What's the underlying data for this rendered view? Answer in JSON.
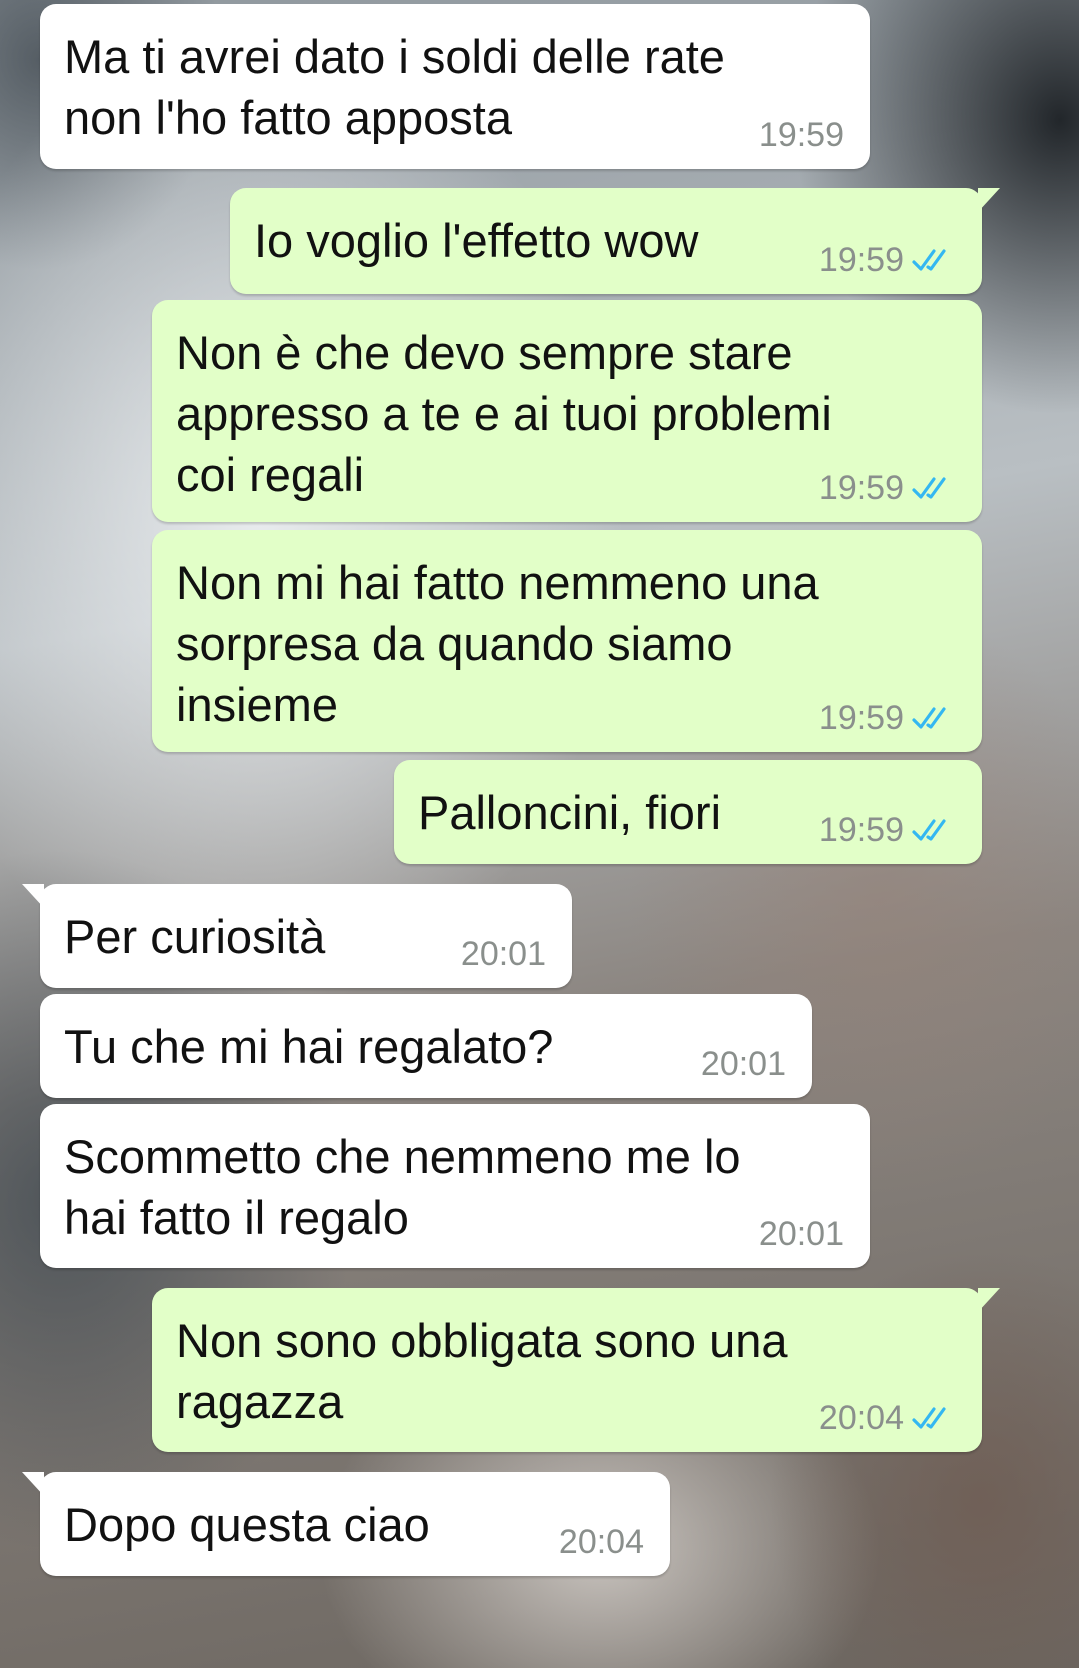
{
  "conversation": {
    "messages": [
      {
        "direction": "in",
        "text": "Ma ti avrei dato i soldi delle rate\nnon l'ho fatto apposta",
        "time": "19:59"
      },
      {
        "direction": "out",
        "text": "Io voglio l'effetto wow",
        "time": "19:59",
        "status": "read"
      },
      {
        "direction": "out",
        "text": "Non è che devo sempre stare\nappresso a te e ai tuoi problemi\ncoi regali",
        "time": "19:59",
        "status": "read"
      },
      {
        "direction": "out",
        "text": "Non mi hai fatto nemmeno una\nsorpresa da quando siamo\ninsieme",
        "time": "19:59",
        "status": "read"
      },
      {
        "direction": "out",
        "text": "Palloncini, fiori",
        "time": "19:59",
        "status": "read"
      },
      {
        "direction": "in",
        "text": "Per curiosità",
        "time": "20:01"
      },
      {
        "direction": "in",
        "text": "Tu che mi hai regalato?",
        "time": "20:01"
      },
      {
        "direction": "in",
        "text": "Scommetto che nemmeno me lo\nhai fatto il regalo",
        "time": "20:01"
      },
      {
        "direction": "out",
        "text": "Non sono obbligata sono una\nragazza",
        "time": "20:04",
        "status": "read"
      },
      {
        "direction": "in",
        "text": "Dopo questa ciao",
        "time": "20:04"
      }
    ]
  },
  "colors": {
    "incoming_bubble": "#ffffff",
    "outgoing_bubble": "#e2ffc8",
    "read_ticks": "#34b7f1",
    "timestamp": "#8a8f8c"
  },
  "icons": {
    "read_status": "double-check-icon"
  }
}
